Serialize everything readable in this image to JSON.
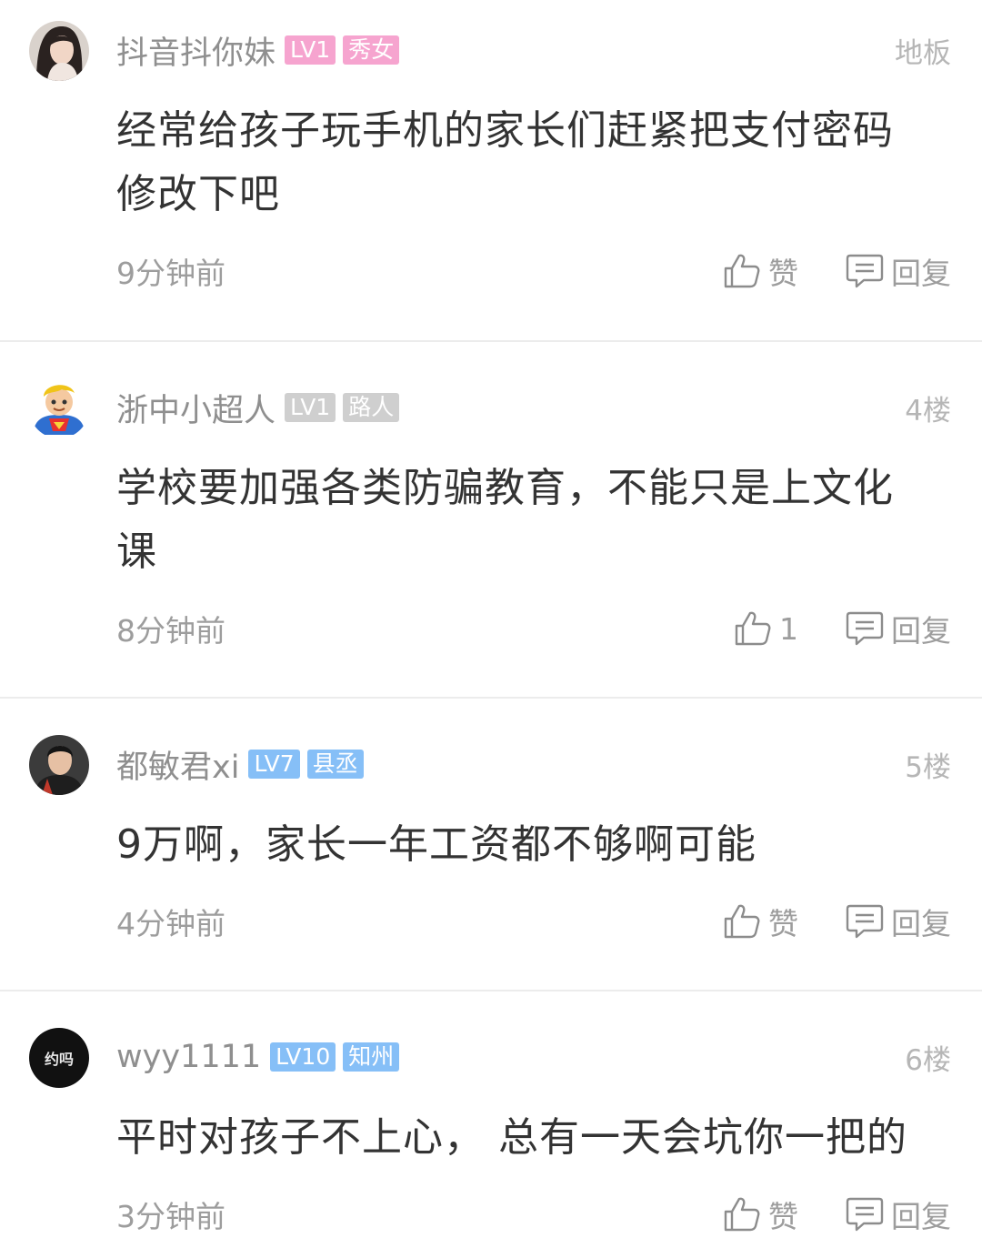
{
  "colors": {
    "badge_pink": "#f6a4cf",
    "badge_gray": "#cfcfcf",
    "badge_blue": "#86bff7",
    "divider": "#ececec",
    "meta_text": "#9d9d9d"
  },
  "comments": [
    {
      "username": "抖音抖你妹",
      "level": "LV1",
      "title": "秀女",
      "badge_color": "#f6a4cf",
      "floor": "地板",
      "avatar_icon": "girl-avatar-icon",
      "content": "经常给孩子玩手机的家长们赶紧把支付密码修改下吧",
      "time": "9分钟前",
      "like_label": "赞",
      "reply_label": "回复"
    },
    {
      "username": "浙中小超人",
      "level": "LV1",
      "title": "路人",
      "badge_color": "#cfcfcf",
      "floor": "4楼",
      "avatar_icon": "superman-avatar-icon",
      "content": "学校要加强各类防骗教育，不能只是上文化课",
      "time": "8分钟前",
      "like_label": "1",
      "reply_label": "回复"
    },
    {
      "username": "都敏君xi",
      "level": "LV7",
      "title": "县丞",
      "badge_color": "#86bff7",
      "floor": "5楼",
      "avatar_icon": "man-avatar-icon",
      "content": "9万啊，家长一年工资都不够啊可能",
      "time": "4分钟前",
      "like_label": "赞",
      "reply_label": "回复"
    },
    {
      "username": "wyy1111",
      "level": "LV10",
      "title": "知州",
      "badge_color": "#86bff7",
      "floor": "6楼",
      "avatar_icon": "logo-avatar-icon",
      "avatar_text": "约吗",
      "content": "平时对孩子不上心， 总有一天会坑你一把的",
      "time": "3分钟前",
      "like_label": "赞",
      "reply_label": "回复"
    }
  ]
}
